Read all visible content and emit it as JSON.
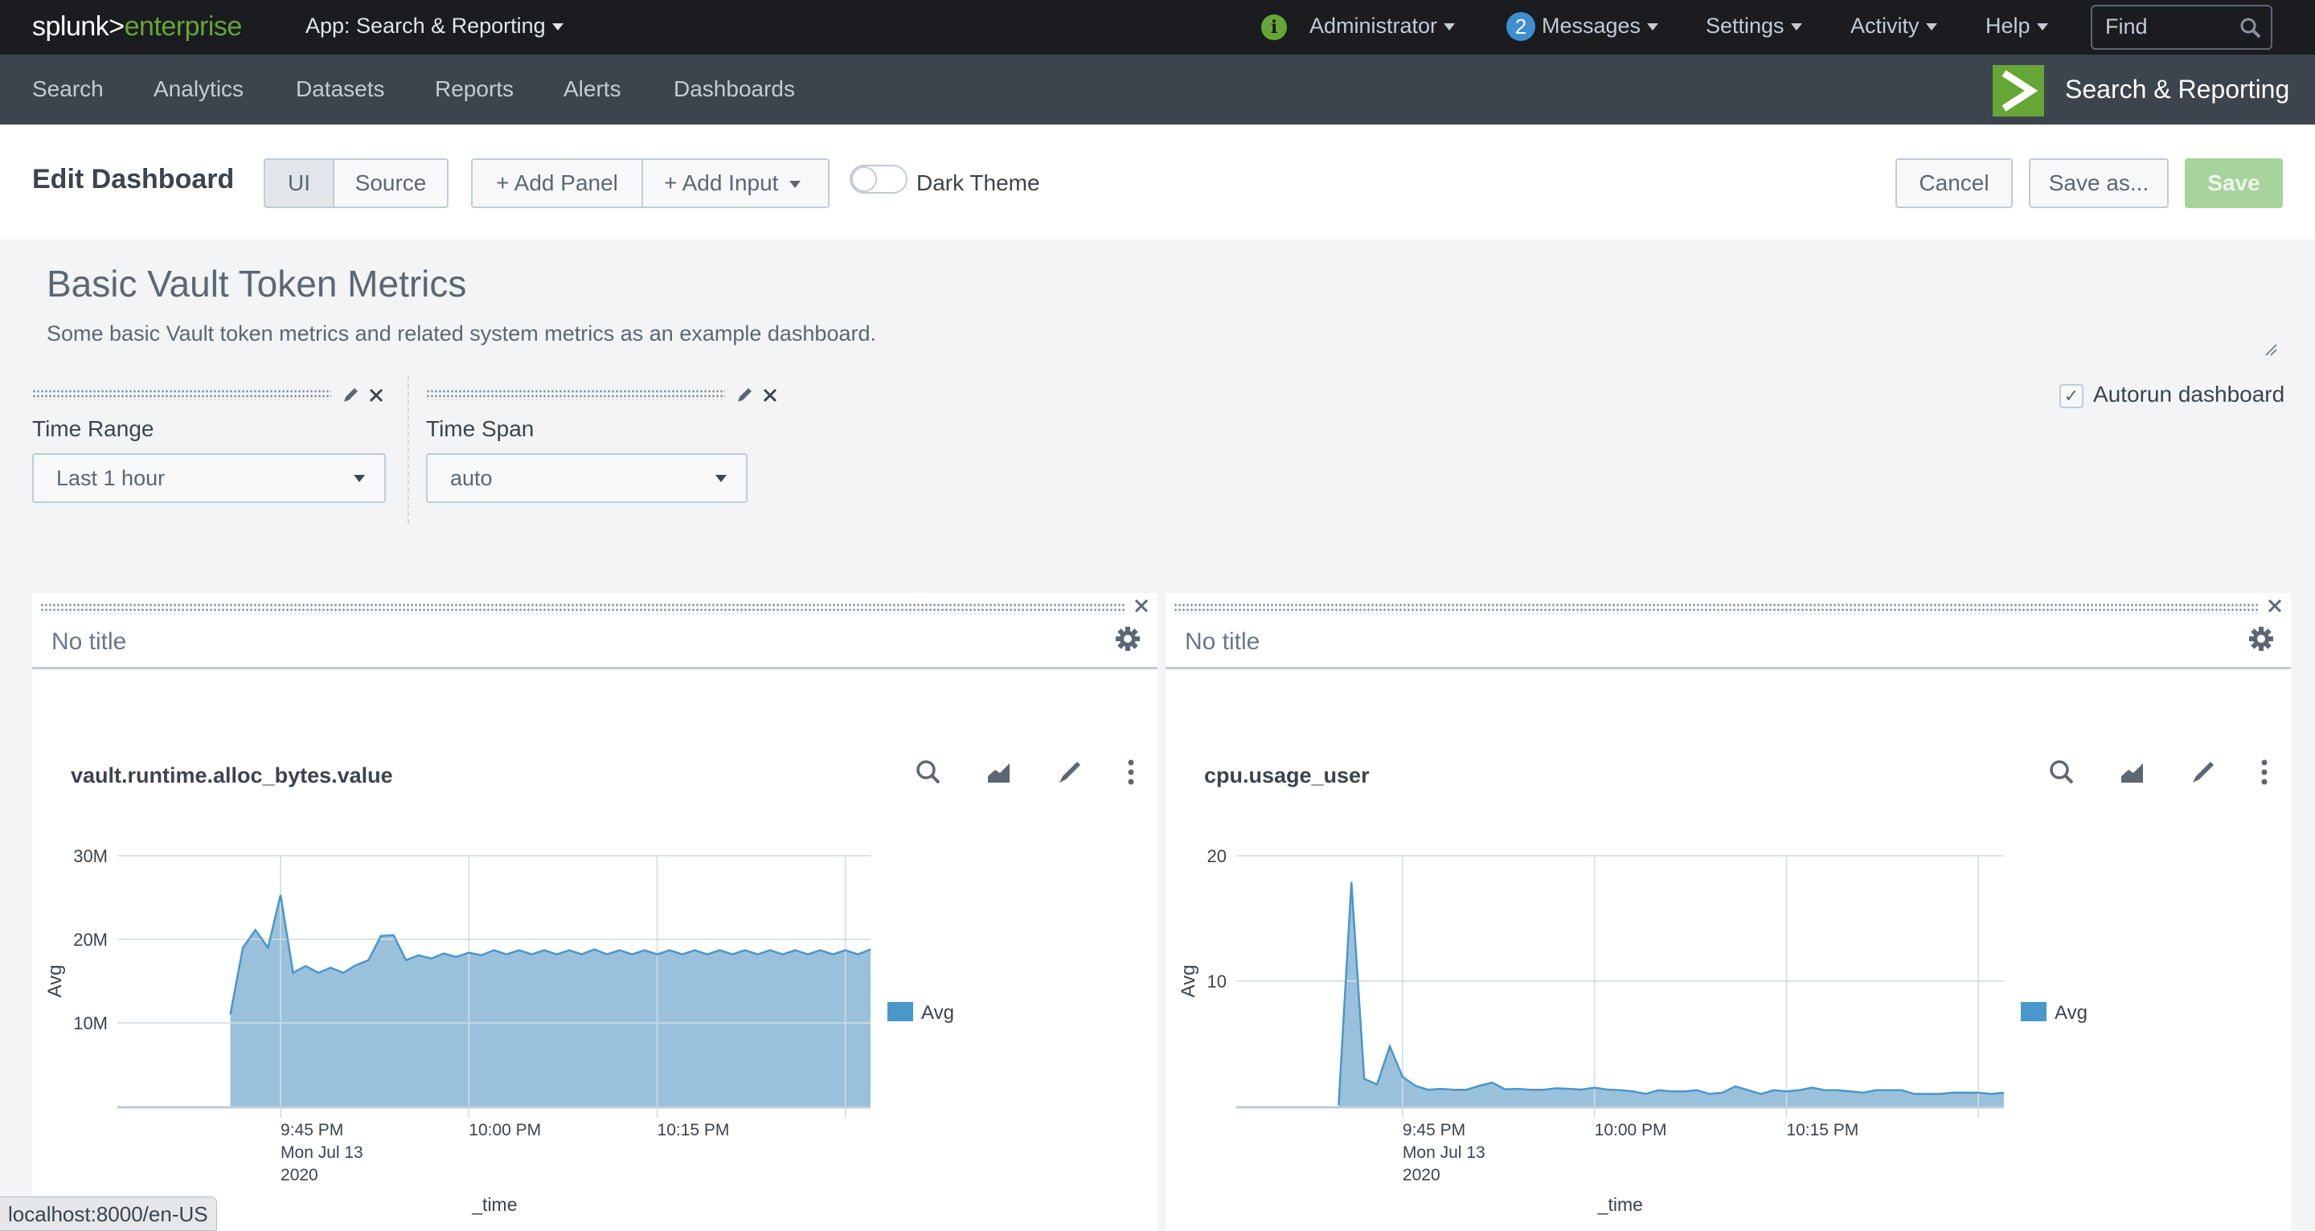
{
  "topbar": {
    "logo_primary": "splunk>",
    "logo_secondary": "enterprise",
    "app_menu": "App: Search & Reporting",
    "user": "Administrator",
    "messages_count": "2",
    "messages": "Messages",
    "settings": "Settings",
    "activity": "Activity",
    "help": "Help",
    "find_placeholder": "Find"
  },
  "app_nav": {
    "items": [
      "Search",
      "Analytics",
      "Datasets",
      "Reports",
      "Alerts",
      "Dashboards"
    ],
    "app_title": "Search & Reporting"
  },
  "edit_bar": {
    "title": "Edit Dashboard",
    "mode_ui": "UI",
    "mode_source": "Source",
    "active_mode": "UI",
    "add_panel": "+ Add Panel",
    "add_input": "+ Add Input",
    "dark_theme_label": "Dark Theme",
    "dark_theme_on": false,
    "cancel": "Cancel",
    "save_as": "Save as...",
    "save": "Save"
  },
  "dashboard": {
    "title": "Basic Vault Token Metrics",
    "description": "Some basic Vault token metrics and related system metrics as an example dashboard.",
    "autorun_label": "Autorun dashboard",
    "autorun_checked": true
  },
  "inputs": [
    {
      "label": "Time Range",
      "value": "Last 1 hour"
    },
    {
      "label": "Time Span",
      "value": "auto"
    }
  ],
  "panels": [
    {
      "title": "No title",
      "viz_title": "vault.runtime.alloc_bytes.value"
    },
    {
      "title": "No title",
      "viz_title": "cpu.usage_user"
    }
  ],
  "status_url": "localhost:8000/en-US",
  "colors": {
    "series": "#4a97cc",
    "series_fill": "#9ac1dc",
    "accent_green": "#65a637",
    "badge_blue": "#3e8ed0"
  },
  "chart_data": [
    {
      "type": "area",
      "title": "vault.runtime.alloc_bytes.value",
      "xlabel": "_time",
      "ylabel": "Avg",
      "x_range": [
        "9:32 PM",
        "10:32 PM"
      ],
      "x_start": "9:41 PM",
      "x_step_minutes": 1,
      "ylim": [
        0,
        30000000
      ],
      "yticks": [
        {
          "value": 10000000,
          "label": "10M"
        },
        {
          "value": 20000000,
          "label": "20M"
        },
        {
          "value": 30000000,
          "label": "30M"
        }
      ],
      "xticks": [
        {
          "minute": 13,
          "label": [
            "9:45 PM",
            "Mon Jul 13",
            "2020"
          ]
        },
        {
          "minute": 28,
          "label": [
            "10:00 PM"
          ]
        },
        {
          "minute": 43,
          "label": [
            "10:15 PM"
          ]
        },
        {
          "minute": 58,
          "label": []
        }
      ],
      "grid": true,
      "legend": {
        "position": "right",
        "entries": [
          "Avg"
        ]
      },
      "series": [
        {
          "name": "Avg",
          "start_minute": 9,
          "values": [
            11000000,
            19000000,
            21100000,
            19000000,
            25300000,
            16000000,
            16800000,
            16000000,
            16600000,
            16000000,
            16900000,
            17500000,
            20400000,
            20500000,
            17500000,
            18100000,
            17700000,
            18300000,
            17900000,
            18400000,
            18100000,
            18700000,
            18200000,
            18700000,
            18200000,
            18700000,
            18200000,
            18700000,
            18200000,
            18800000,
            18200000,
            18700000,
            18200000,
            18700000,
            18200000,
            18700000,
            18200000,
            18700000,
            18200000,
            18700000,
            18200000,
            18700000,
            18200000,
            18700000,
            18200000,
            18700000,
            18200000,
            18700000,
            18200000,
            18700000,
            18200000,
            18800000
          ]
        }
      ]
    },
    {
      "type": "area",
      "title": "cpu.usage_user",
      "xlabel": "_time",
      "ylabel": "Avg",
      "x_range": [
        "9:32 PM",
        "10:32 PM"
      ],
      "x_start": "9:40 PM",
      "x_step_minutes": 1,
      "ylim": [
        0,
        20
      ],
      "yticks": [
        {
          "value": 10,
          "label": "10"
        },
        {
          "value": 20,
          "label": "20"
        }
      ],
      "xticks": [
        {
          "minute": 13,
          "label": [
            "9:45 PM",
            "Mon Jul 13",
            "2020"
          ]
        },
        {
          "minute": 28,
          "label": [
            "10:00 PM"
          ]
        },
        {
          "minute": 43,
          "label": [
            "10:15 PM"
          ]
        },
        {
          "minute": 58,
          "label": []
        }
      ],
      "grid": true,
      "legend": {
        "position": "right",
        "entries": [
          "Avg"
        ]
      },
      "series": [
        {
          "name": "Avg",
          "start_minute": 8,
          "values": [
            0.1,
            17.9,
            2.2,
            1.75,
            4.8,
            2.35,
            1.65,
            1.33,
            1.4,
            1.33,
            1.33,
            1.65,
            1.9,
            1.37,
            1.4,
            1.33,
            1.33,
            1.45,
            1.4,
            1.35,
            1.5,
            1.35,
            1.3,
            1.2,
            1.0,
            1.3,
            1.2,
            1.2,
            1.3,
            1.0,
            1.1,
            1.6,
            1.3,
            1.0,
            1.3,
            1.2,
            1.3,
            1.5,
            1.3,
            1.3,
            1.2,
            1.1,
            1.3,
            1.3,
            1.3,
            1.0,
            1.0,
            1.0,
            1.1,
            1.1,
            1.1,
            1.0,
            1.1
          ]
        }
      ]
    }
  ]
}
